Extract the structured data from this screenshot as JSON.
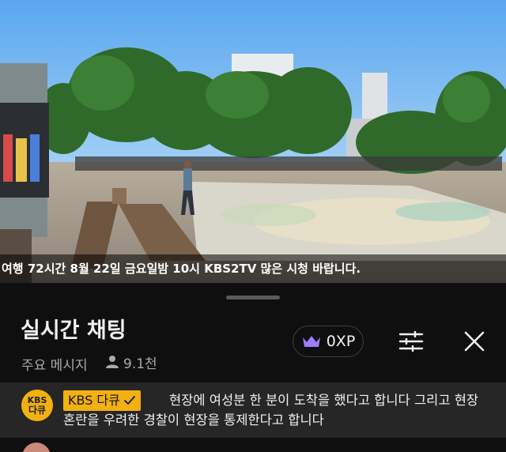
{
  "video": {
    "ticker_text": "여행 72시간 8월 22일 금요일밤 10시 KBS2TV 많은 시청 바랍니다."
  },
  "chat": {
    "title": "실시간 채팅",
    "mode_label": "주요 메시지",
    "viewer_count": "9.1천",
    "xp_label": "0XP",
    "icons": [
      "crown-icon",
      "filter-sliders-icon",
      "close-icon",
      "person-icon",
      "verified-check-icon"
    ],
    "accent_color": "#f2b011"
  },
  "pinned_message": {
    "avatar_text_top": "KBS",
    "avatar_text_bottom": "다큐",
    "author": "KBS 다큐",
    "text": "현장에 여성분 한 분이 도착을 했다고 합니다 그리고 현장 혼란을 우려한 경찰이 현장을 통제한다고 합니다"
  }
}
